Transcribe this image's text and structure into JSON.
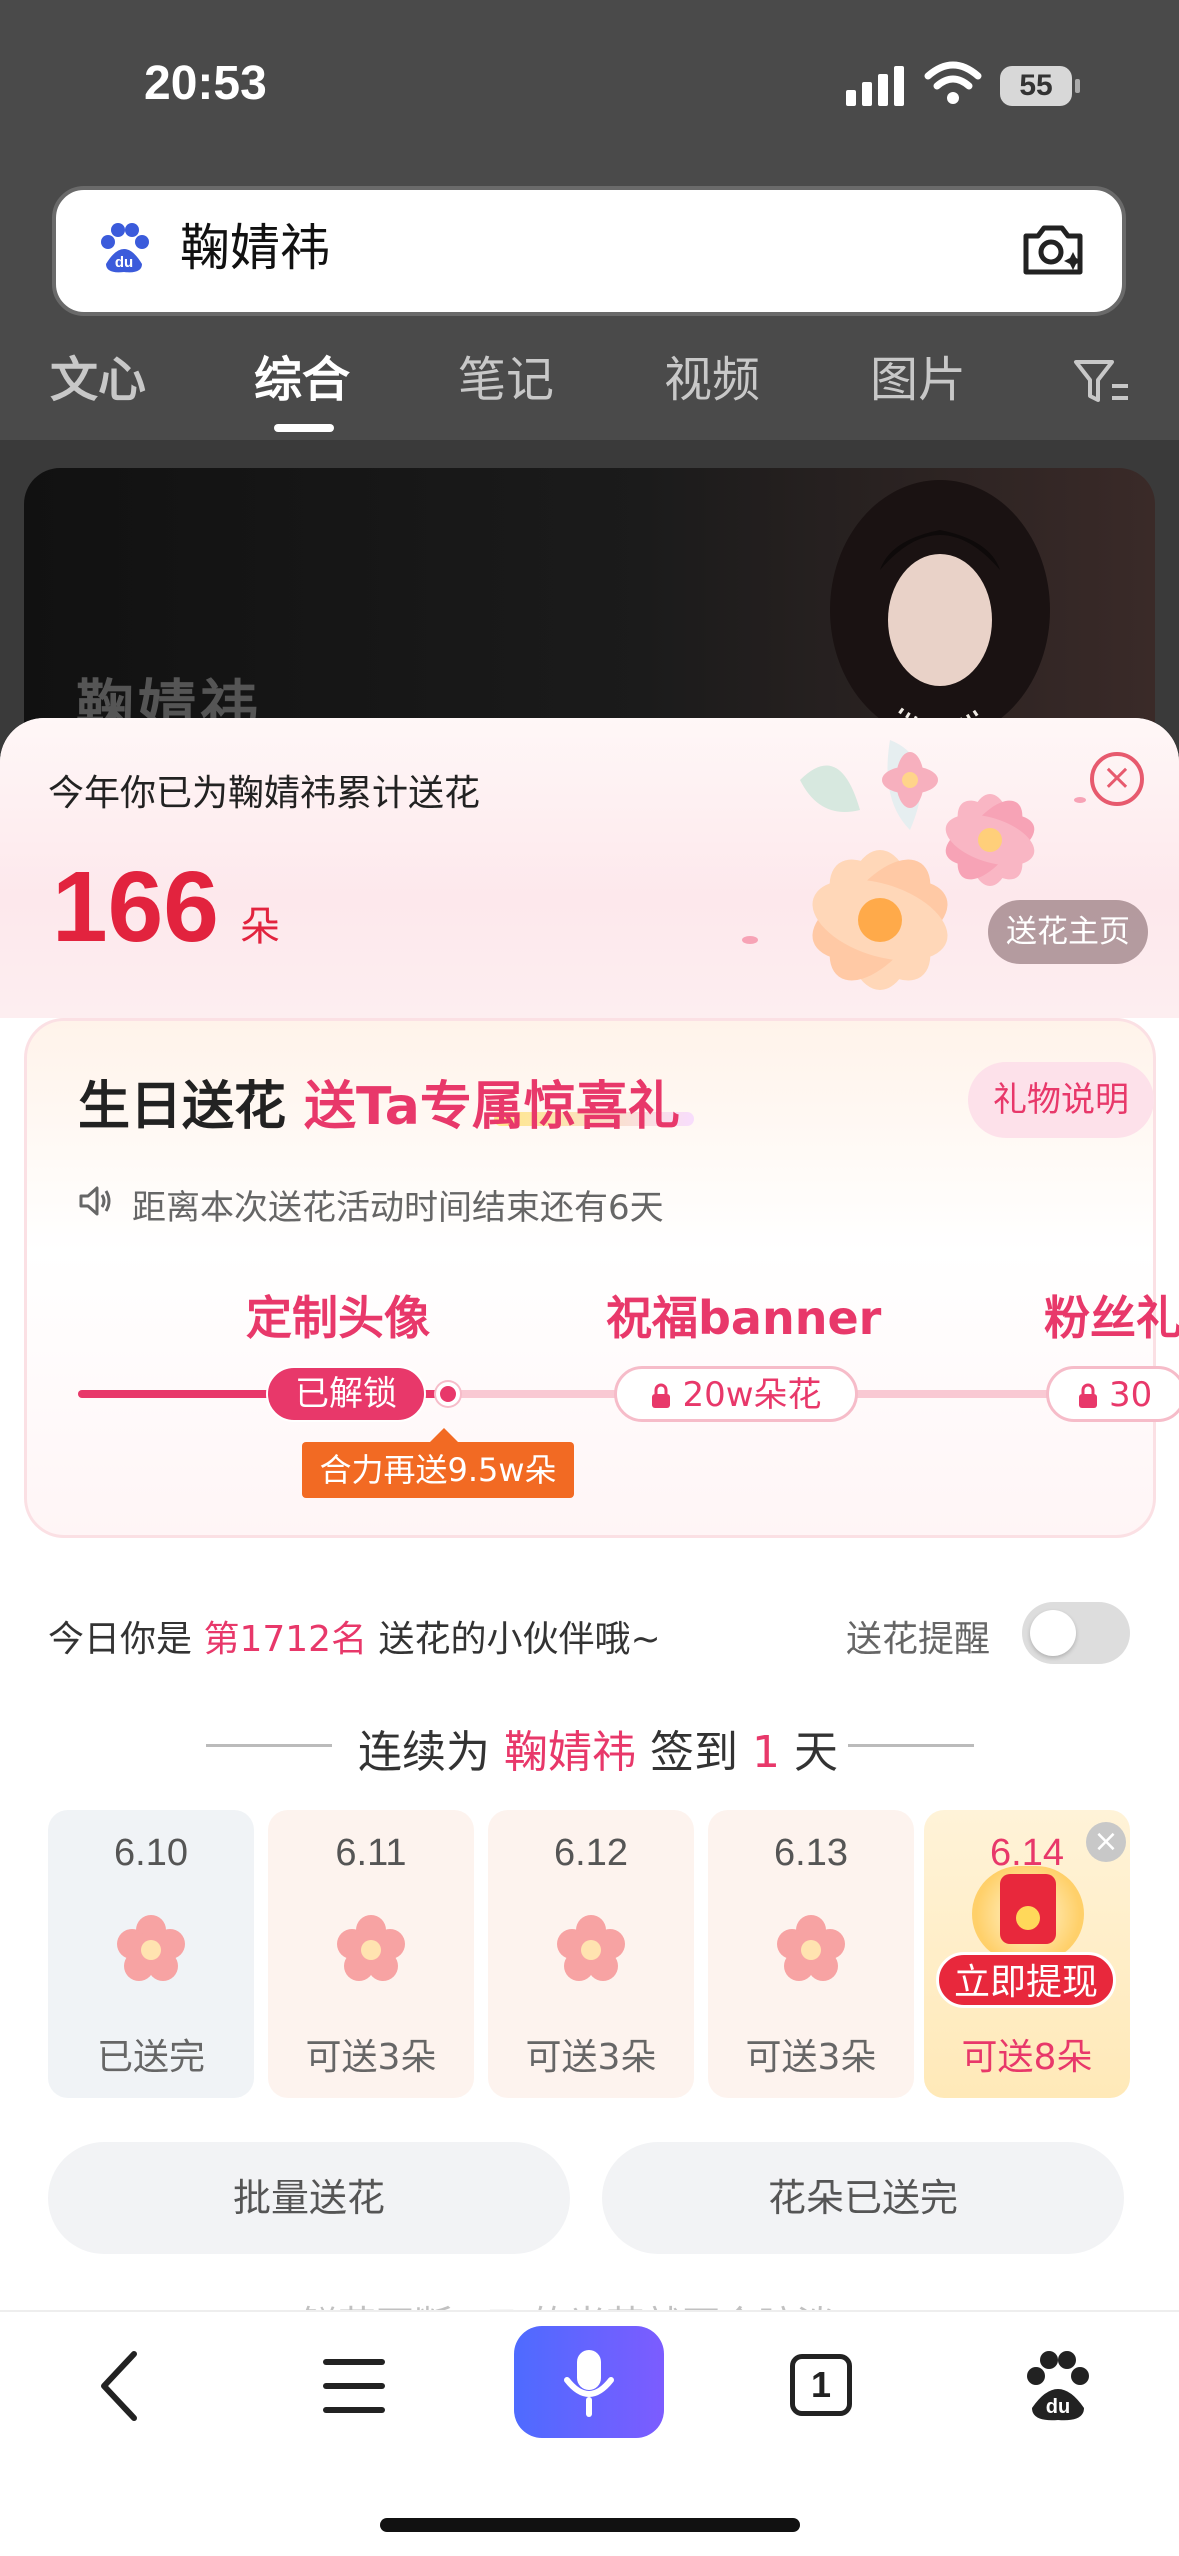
{
  "status_bar": {
    "time": "20:53",
    "battery": "55"
  },
  "search": {
    "query": "鞠婧祎"
  },
  "tabs": [
    "文心",
    "综合",
    "笔记",
    "视频",
    "图片"
  ],
  "hero": {
    "name": "鞠婧祎"
  },
  "summary": {
    "text": "今年你已为鞠婧祎累计送花",
    "count": "166",
    "unit": "朵",
    "close": "×",
    "home_button": "送花主页"
  },
  "birthday": {
    "title": "生日送花",
    "slogan": "送Ta专属惊喜礼",
    "gift_button": "礼物说明",
    "notice": "距离本次送花活动时间结束还有6天",
    "milestones": [
      {
        "label": "定制头像",
        "pill": "已解锁",
        "state": "unlocked"
      },
      {
        "label": "祝福banner",
        "pill": "20w朵花",
        "state": "locked"
      },
      {
        "label": "粉丝礼",
        "pill": "30",
        "state": "locked"
      }
    ],
    "tip": "合力再送9.5w朵"
  },
  "rank": {
    "prefix": "今日你是",
    "rank": "第1712名",
    "suffix": "送花的小伙伴哦~",
    "remind_label": "送花提醒",
    "remind_on": false
  },
  "streak": {
    "prefix": "连续为",
    "name": "鞠婧祎",
    "mid": "签到",
    "days": "1",
    "suffix": "天"
  },
  "days": [
    {
      "date": "6.10",
      "status": "已送完"
    },
    {
      "date": "6.11",
      "status": "可送3朵"
    },
    {
      "date": "6.12",
      "status": "可送3朵"
    },
    {
      "date": "6.13",
      "status": "可送3朵"
    },
    {
      "date": "6.14",
      "status": "可送8朵",
      "badge": "立即提现"
    }
  ],
  "actions": {
    "batch": "批量送花",
    "done": "花朵已送完"
  },
  "faded_text": "鲜花不断，Ta的光芒就不会暗淡",
  "bottom_nav": {
    "tab_count": "1"
  },
  "colors": {
    "accent": "#e8386a",
    "count_red": "#e2233e",
    "tip_orange": "#f26a23",
    "mic_gradient_start": "#4e6bff",
    "mic_gradient_end": "#7c5cff"
  }
}
